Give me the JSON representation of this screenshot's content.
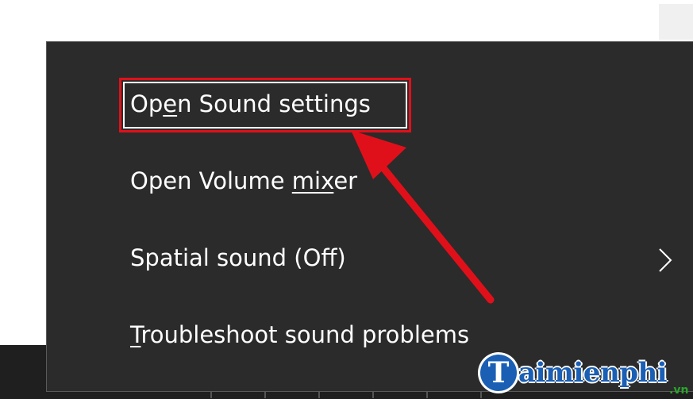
{
  "menu": {
    "items": [
      {
        "pre": "Op",
        "key": "e",
        "post": "n Sound settings",
        "highlighted": true
      },
      {
        "pre": "Open Volume ",
        "key": "mix",
        "post": "er",
        "highlighted": false
      },
      {
        "pre": "Spatial sound (Off)",
        "key": "",
        "post": "",
        "has_submenu": true
      },
      {
        "pre": "",
        "key": "T",
        "post": "roubleshoot sound problems",
        "highlighted": false
      }
    ]
  },
  "icons": {
    "submenu": "chevron-right-icon",
    "annotation": "red-arrow-icon"
  },
  "watermark": {
    "logo_letter": "T",
    "text": "aimienphi",
    "suffix": ".vn"
  },
  "colors": {
    "menu_bg": "#2b2b2b",
    "menu_text": "#ffffff",
    "highlight": "#e0101a",
    "watermark": "#1a5fb4"
  }
}
